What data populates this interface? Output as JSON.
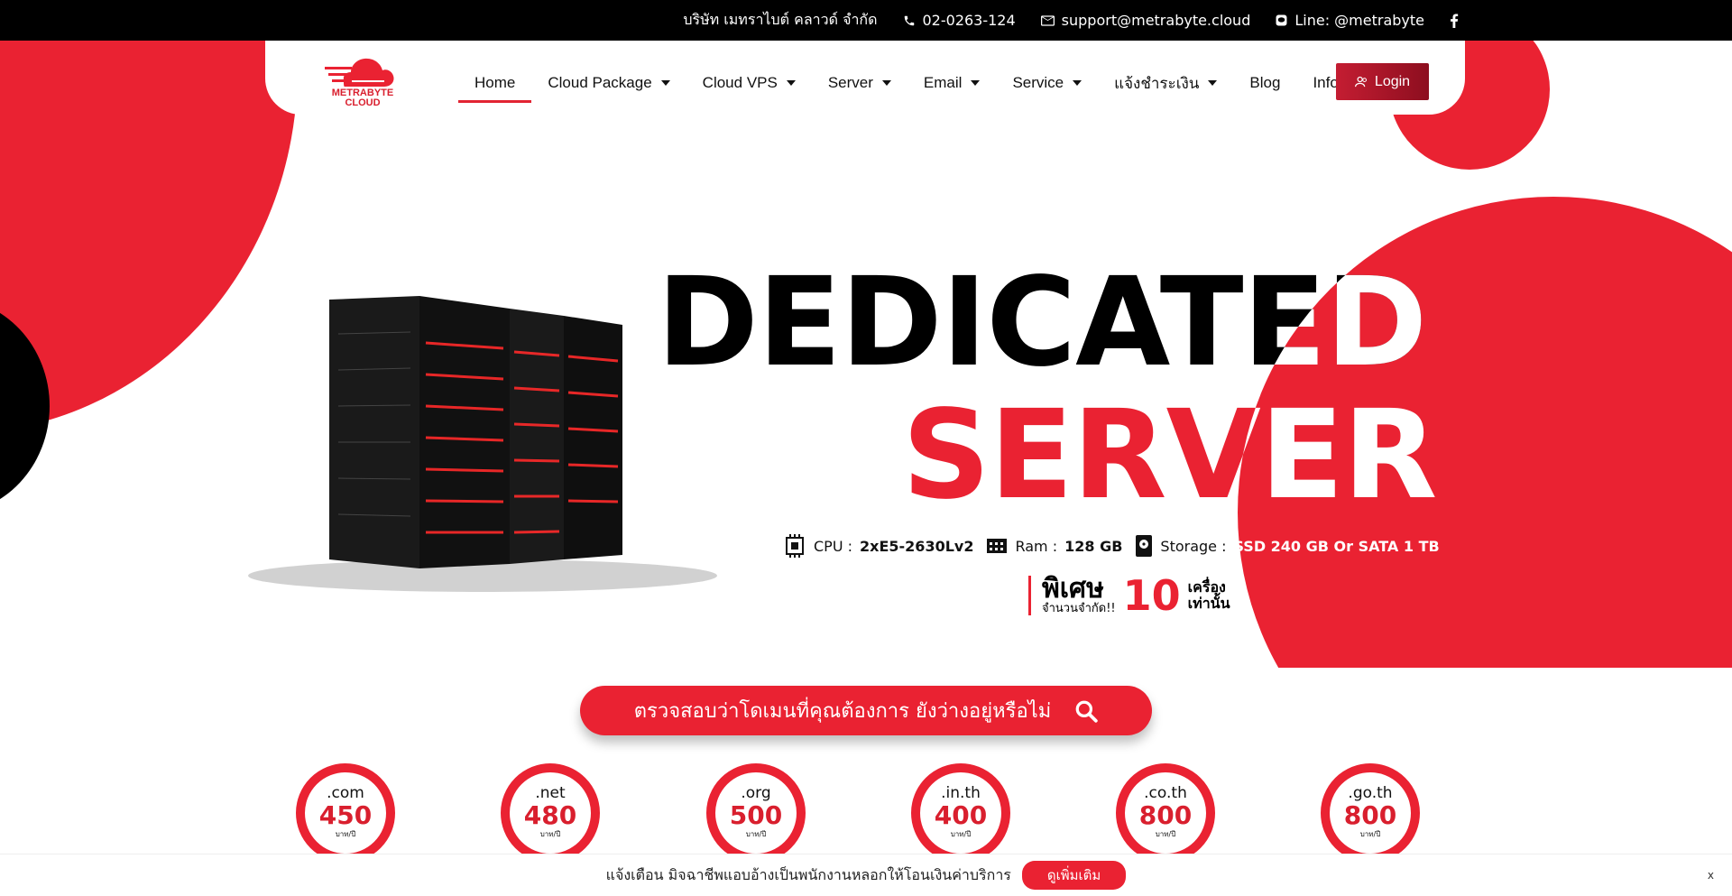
{
  "topbar": {
    "company": "บริษัท เมทราไบต์ คลาวด์ จำกัด",
    "phone": "02-0263-124",
    "email": "support@metrabyte.cloud",
    "line": "Line: @metrabyte",
    "icons": [
      "phone-icon",
      "mail-icon",
      "line-icon",
      "facebook-icon"
    ]
  },
  "brand": {
    "logo_text": "METRABYTE CLOUD",
    "color": "#ea2232"
  },
  "nav": {
    "items": [
      {
        "label": "Home",
        "dropdown": false,
        "active": true
      },
      {
        "label": "Cloud Package",
        "dropdown": true
      },
      {
        "label": "Cloud VPS",
        "dropdown": true
      },
      {
        "label": "Server",
        "dropdown": true
      },
      {
        "label": "Email",
        "dropdown": true
      },
      {
        "label": "Service",
        "dropdown": true
      },
      {
        "label": "แจ้งชำระเงิน",
        "dropdown": true
      },
      {
        "label": "Blog",
        "dropdown": false
      },
      {
        "label": "Info",
        "dropdown": true
      }
    ],
    "login_label": "Login"
  },
  "hero": {
    "title_line1": "DEDICATED",
    "title_line2": "SERVER",
    "specs": {
      "cpu_label": "CPU :",
      "cpu_value": "2xE5-2630Lv2",
      "ram_label": "Ram :",
      "ram_value": "128 GB",
      "storage_label": "Storage :",
      "storage_value": "SSD 240 GB Or SATA 1 TB"
    },
    "promo": {
      "special": "พิเศษ",
      "limited": "จำนวนจำกัด!!",
      "quantity": "10",
      "unit_1": "เครื่อง",
      "unit_2": "เท่านั้น"
    }
  },
  "search": {
    "label": "ตรวจสอบว่าโดเมนที่คุณต้องการ ยังว่างอยู่หรือไม่"
  },
  "domains": [
    {
      "ext": ".com",
      "price": "450",
      "per": "บาท/ปี"
    },
    {
      "ext": ".net",
      "price": "480",
      "per": "บาท/ปี"
    },
    {
      "ext": ".org",
      "price": "500",
      "per": "บาท/ปี"
    },
    {
      "ext": ".in.th",
      "price": "400",
      "per": "บาท/ปี"
    },
    {
      "ext": ".co.th",
      "price": "800",
      "per": "บาท/ปี"
    },
    {
      "ext": ".go.th",
      "price": "800",
      "per": "บาท/ปี"
    }
  ],
  "notice": {
    "text": "แจ้งเตือน มิจฉาชีพแอบอ้างเป็นพนักงานหลอกให้โอนเงินค่าบริการ",
    "button": "ดูเพิ่มเติม",
    "close": "x"
  }
}
